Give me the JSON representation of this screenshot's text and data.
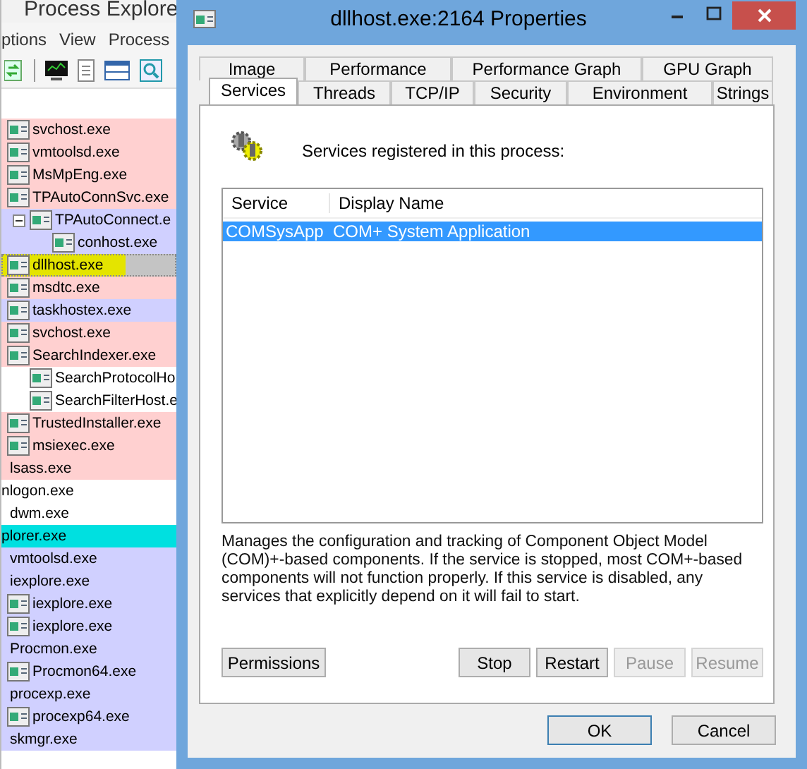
{
  "background_window": {
    "title": "Process Explore",
    "menu": [
      "ptions",
      "View",
      "Process"
    ],
    "processes": [
      {
        "name": "svchost.exe",
        "color": "#ffd0d0",
        "selected": false,
        "highlighted": false
      },
      {
        "name": "vmtoolsd.exe",
        "color": "#ffd0d0",
        "selected": false,
        "highlighted": false
      },
      {
        "name": "MsMpEng.exe",
        "color": "#ffd0d0",
        "selected": false,
        "highlighted": false
      },
      {
        "name": "TPAutoConnSvc.exe",
        "color": "#ffd0d0",
        "selected": false,
        "highlighted": false,
        "children": [
          {
            "name": "TPAutoConnect.e",
            "color": "#d0d0ff",
            "selected": false,
            "highlighted": false,
            "children": [
              {
                "name": "conhost.exe",
                "color": "#d0d0ff",
                "selected": false,
                "highlighted": false
              }
            ]
          }
        ]
      },
      {
        "name": "dllhost.exe",
        "color": "#c4c4c4",
        "selected": true,
        "highlighted": true
      },
      {
        "name": "msdtc.exe",
        "color": "#ffd0d0",
        "selected": false,
        "highlighted": false
      },
      {
        "name": "taskhostex.exe",
        "color": "#d0d0ff",
        "selected": false,
        "highlighted": false
      },
      {
        "name": "svchost.exe",
        "color": "#ffd0d0",
        "selected": false,
        "highlighted": false
      },
      {
        "name": "SearchIndexer.exe",
        "color": "#ffd0d0",
        "selected": false,
        "highlighted": false,
        "children": [
          {
            "name": "SearchProtocolHo",
            "color": "#ffffff",
            "selected": false,
            "highlighted": false
          },
          {
            "name": "SearchFilterHost.e",
            "color": "#ffffff",
            "selected": false,
            "highlighted": false
          }
        ]
      },
      {
        "name": "TrustedInstaller.exe",
        "color": "#ffd0d0",
        "selected": false,
        "highlighted": false
      },
      {
        "name": "msiexec.exe",
        "color": "#ffd0d0",
        "selected": false,
        "highlighted": false
      },
      {
        "name": "lsass.exe",
        "color": "#ffd0d0",
        "selected": false,
        "highlighted": false
      },
      {
        "name": "nlogon.exe",
        "color": "#ffffff",
        "selected": false,
        "highlighted": false,
        "children": [
          {
            "name": "dwm.exe",
            "color": "#ffffff",
            "selected": false,
            "highlighted": false
          }
        ]
      },
      {
        "name": "plorer.exe",
        "color": "#00e0e0",
        "selected": false,
        "highlighted": false,
        "children": [
          {
            "name": "vmtoolsd.exe",
            "color": "#d0d0ff",
            "selected": false,
            "highlighted": false
          },
          {
            "name": "iexplore.exe",
            "color": "#d0d0ff",
            "selected": false,
            "highlighted": false,
            "children": [
              {
                "name": "iexplore.exe",
                "color": "#d0d0ff",
                "selected": false,
                "highlighted": false
              },
              {
                "name": "iexplore.exe",
                "color": "#d0d0ff",
                "selected": false,
                "highlighted": false
              }
            ]
          },
          {
            "name": "Procmon.exe",
            "color": "#d0d0ff",
            "selected": false,
            "highlighted": false,
            "children": [
              {
                "name": "Procmon64.exe",
                "color": "#d0d0ff",
                "selected": false,
                "highlighted": false
              }
            ]
          },
          {
            "name": "procexp.exe",
            "color": "#d0d0ff",
            "selected": false,
            "highlighted": false,
            "children": [
              {
                "name": "procexp64.exe",
                "color": "#d0d0ff",
                "selected": false,
                "highlighted": false
              }
            ]
          },
          {
            "name": "skmgr.exe",
            "color": "#d0d0ff",
            "selected": false,
            "highlighted": false
          }
        ]
      }
    ]
  },
  "dialog": {
    "title": "dllhost.exe:2164 Properties",
    "tab_rows": [
      [
        {
          "label": "Image",
          "selected": false
        },
        {
          "label": "Performance",
          "selected": false
        },
        {
          "label": "Performance Graph",
          "selected": false
        },
        {
          "label": "GPU Graph",
          "selected": false
        }
      ],
      [
        {
          "label": "Services",
          "selected": true
        },
        {
          "label": "Threads",
          "selected": false
        },
        {
          "label": "TCP/IP",
          "selected": false
        },
        {
          "label": "Security",
          "selected": false
        },
        {
          "label": "Environment",
          "selected": false
        },
        {
          "label": "Strings",
          "selected": false
        }
      ]
    ],
    "heading": "Services registered in this process:",
    "columns": [
      "Service",
      "Display Name"
    ],
    "services": [
      {
        "service": "COMSysApp",
        "display_name": "COM+ System Application",
        "selected": true
      }
    ],
    "description": "Manages the configuration and tracking of Component Object Model (COM)+-based components. If the service is stopped, most COM+-based components will not function properly. If this service is disabled, any services that explicitly depend on it will fail to start.",
    "left_buttons": [
      {
        "label": "Permissions",
        "disabled": false
      }
    ],
    "service_buttons": [
      {
        "label": "Stop",
        "disabled": false
      },
      {
        "label": "Restart",
        "disabled": false
      },
      {
        "label": "Pause",
        "disabled": true
      },
      {
        "label": "Resume",
        "disabled": true
      }
    ],
    "footer_buttons": [
      {
        "label": "OK",
        "default": true
      },
      {
        "label": "Cancel",
        "default": false
      }
    ]
  }
}
